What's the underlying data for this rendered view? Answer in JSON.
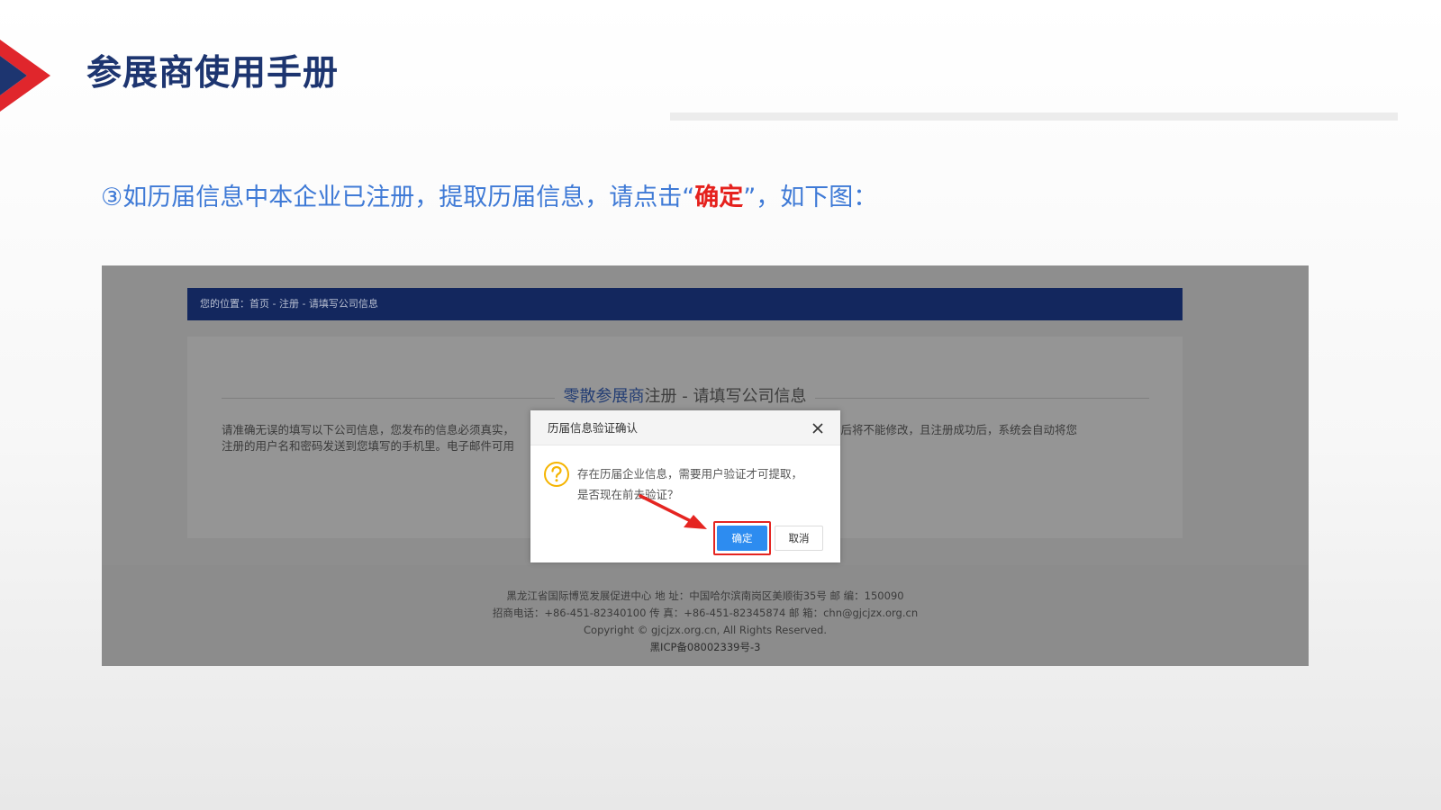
{
  "header": {
    "title": "参展商使用手册"
  },
  "instruction": {
    "prefix": "③如历届信息中本企业已注册，提取历届信息，请点击“",
    "highlight": "确定",
    "suffix": "”，如下图："
  },
  "screenshot": {
    "breadcrumb": "您的位置：首页 - 注册 - 请填写公司信息",
    "form": {
      "heading_part_a": "零散参展商",
      "heading_part_b": "注册 - 请填写公司信息",
      "note_line1_left": "请准确无误的填写以下公司信息，您发布的信息必须真实，",
      "note_line1_right": "经审核通过后将不能修改，且注册成功后，系统会自动将您",
      "note_line2_left": "注册的用户名和密码发送到您填写的手机里。电子邮件可用"
    },
    "modal": {
      "title": "历届信息验证确认",
      "close_glyph": "×",
      "message_line1": "存在历届企业信息，需要用户验证才可提取，",
      "message_line2": "是否现在前去验证？",
      "confirm_label": "确定",
      "cancel_label": "取消"
    },
    "footer": {
      "line1": "黑龙江省国际博览发展促进中心 地 址：中国哈尔滨南岗区美顺街35号 邮 编：150090",
      "line2": "招商电话：+86-451-82340100 传 真：+86-451-82345874 邮 箱：chn@gjcjzx.org.cn",
      "line3": "Copyright © gjcjzx.org.cn, All Rights Reserved.",
      "line4": "黑ICP备08002339号-3"
    }
  },
  "colors": {
    "title": "#1d3570",
    "instruction": "#3f7ad6",
    "highlight": "#e5211d",
    "nav_bar": "#13275e",
    "confirm_button": "#2d8cf0",
    "focus_outline": "#e52521"
  },
  "icons": {
    "logo": "chevron-arrow-logo",
    "close": "close-icon",
    "question": "question-circle-icon",
    "pointer": "red-arrow-pointer"
  }
}
